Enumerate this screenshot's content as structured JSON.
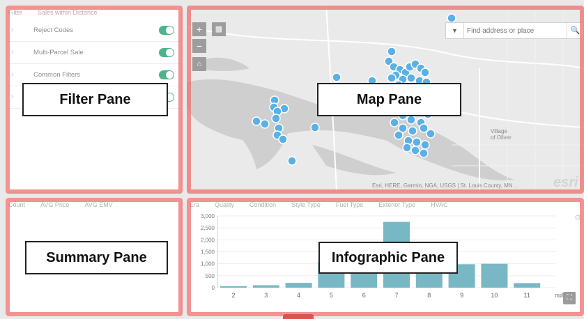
{
  "filter_pane": {
    "tabs": [
      "Filter",
      "Sales within Distance"
    ],
    "items": [
      {
        "label": "Reject Codes",
        "on": true
      },
      {
        "label": "Multi-Parcel Sale",
        "on": true
      },
      {
        "label": "Common Filters",
        "on": true
      },
      {
        "label": "",
        "on": true
      }
    ],
    "annotation": "Filter Pane"
  },
  "map_pane": {
    "search_placeholder": "Find address or place",
    "attribution": "Esri, HERE, Garmin, NGA, USGS | St. Louis County, MN ...",
    "place_label_line1": "Village",
    "place_label_line2": "of Oliver",
    "logo_text": "esri",
    "annotation": "Map Pane"
  },
  "summary_pane": {
    "tabs": [
      "Count",
      "AVG Price",
      "AVG EMV"
    ],
    "annotation": "Summary Pane"
  },
  "infographic_pane": {
    "tabs": [
      "Era",
      "Quality",
      "Condition",
      "Style Type",
      "Fuel Type",
      "Exterior Type",
      "HVAC"
    ],
    "annotation": "Infographic Pane",
    "colors": {
      "bar": "#78b7c4"
    }
  },
  "chart_data": {
    "type": "bar",
    "categories": [
      "2",
      "3",
      "4",
      "5",
      "6",
      "7",
      "8",
      "9",
      "10",
      "11",
      "null"
    ],
    "values": [
      60,
      100,
      200,
      1080,
      1180,
      2750,
      1180,
      980,
      1000,
      190,
      0
    ],
    "yticks": [
      "3,000",
      "2,500",
      "2,000",
      "1,500",
      "1,000",
      "500",
      "0"
    ],
    "ylim": [
      0,
      3000
    ]
  },
  "map_points": [
    [
      380,
      18
    ],
    [
      294,
      66
    ],
    [
      215,
      103
    ],
    [
      266,
      108
    ],
    [
      126,
      136
    ],
    [
      125,
      146
    ],
    [
      140,
      148
    ],
    [
      130,
      152
    ],
    [
      128,
      162
    ],
    [
      100,
      166
    ],
    [
      112,
      170
    ],
    [
      132,
      176
    ],
    [
      130,
      186
    ],
    [
      138,
      192
    ],
    [
      184,
      175
    ],
    [
      151,
      223
    ],
    [
      290,
      80
    ],
    [
      297,
      88
    ],
    [
      306,
      92
    ],
    [
      314,
      96
    ],
    [
      320,
      88
    ],
    [
      328,
      84
    ],
    [
      336,
      90
    ],
    [
      342,
      96
    ],
    [
      300,
      100
    ],
    [
      310,
      106
    ],
    [
      322,
      104
    ],
    [
      334,
      108
    ],
    [
      344,
      110
    ],
    [
      294,
      104
    ],
    [
      304,
      114
    ],
    [
      316,
      116
    ],
    [
      330,
      118
    ],
    [
      340,
      120
    ],
    [
      348,
      128
    ],
    [
      300,
      124
    ],
    [
      314,
      132
    ],
    [
      328,
      128
    ],
    [
      340,
      140
    ],
    [
      306,
      140
    ],
    [
      320,
      146
    ],
    [
      334,
      150
    ],
    [
      346,
      156
    ],
    [
      310,
      158
    ],
    [
      322,
      164
    ],
    [
      336,
      168
    ],
    [
      298,
      168
    ],
    [
      310,
      176
    ],
    [
      324,
      180
    ],
    [
      340,
      176
    ],
    [
      350,
      184
    ],
    [
      304,
      186
    ],
    [
      318,
      194
    ],
    [
      330,
      196
    ],
    [
      342,
      200
    ],
    [
      316,
      204
    ],
    [
      328,
      208
    ],
    [
      340,
      212
    ],
    [
      344,
      120
    ]
  ]
}
